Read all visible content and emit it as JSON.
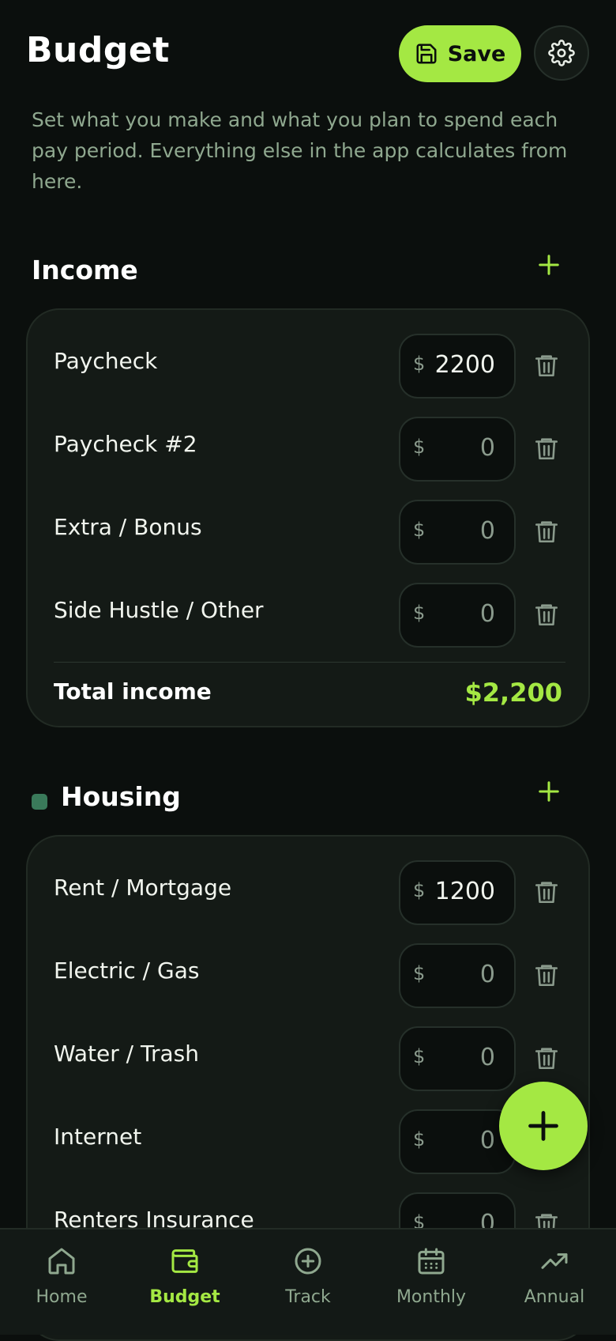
{
  "header": {
    "title": "Budget",
    "save_label": "Save"
  },
  "intro": "Set what you make and what you plan to spend each pay period. Everything else in the app calculates from here.",
  "income": {
    "title": "Income",
    "rows": [
      {
        "label": "Paycheck",
        "currency": "$",
        "value": "2200"
      },
      {
        "label": "Paycheck #2",
        "currency": "$",
        "value": "0"
      },
      {
        "label": "Extra / Bonus",
        "currency": "$",
        "value": "0"
      },
      {
        "label": "Side Hustle / Other",
        "currency": "$",
        "value": "0"
      }
    ],
    "total_label": "Total income",
    "total_value": "$2,200"
  },
  "housing": {
    "title": "Housing",
    "color": "#3a7a5a",
    "rows": [
      {
        "label": "Rent / Mortgage",
        "currency": "$",
        "value": "1200"
      },
      {
        "label": "Electric / Gas",
        "currency": "$",
        "value": "0"
      },
      {
        "label": "Water / Trash",
        "currency": "$",
        "value": "0"
      },
      {
        "label": "Internet",
        "currency": "$",
        "value": "0"
      },
      {
        "label": "Renters Insurance",
        "currency": "$",
        "value": "0"
      }
    ]
  },
  "nav": {
    "items": [
      {
        "label": "Home",
        "icon": "home-icon"
      },
      {
        "label": "Budget",
        "icon": "wallet-icon",
        "active": true
      },
      {
        "label": "Track",
        "icon": "plus-circle-icon"
      },
      {
        "label": "Monthly",
        "icon": "calendar-icon"
      },
      {
        "label": "Annual",
        "icon": "trend-icon"
      }
    ]
  },
  "colors": {
    "accent": "#a4e843",
    "background": "#0b0f0d",
    "card": "#141a16",
    "muted": "#8fa88f"
  }
}
